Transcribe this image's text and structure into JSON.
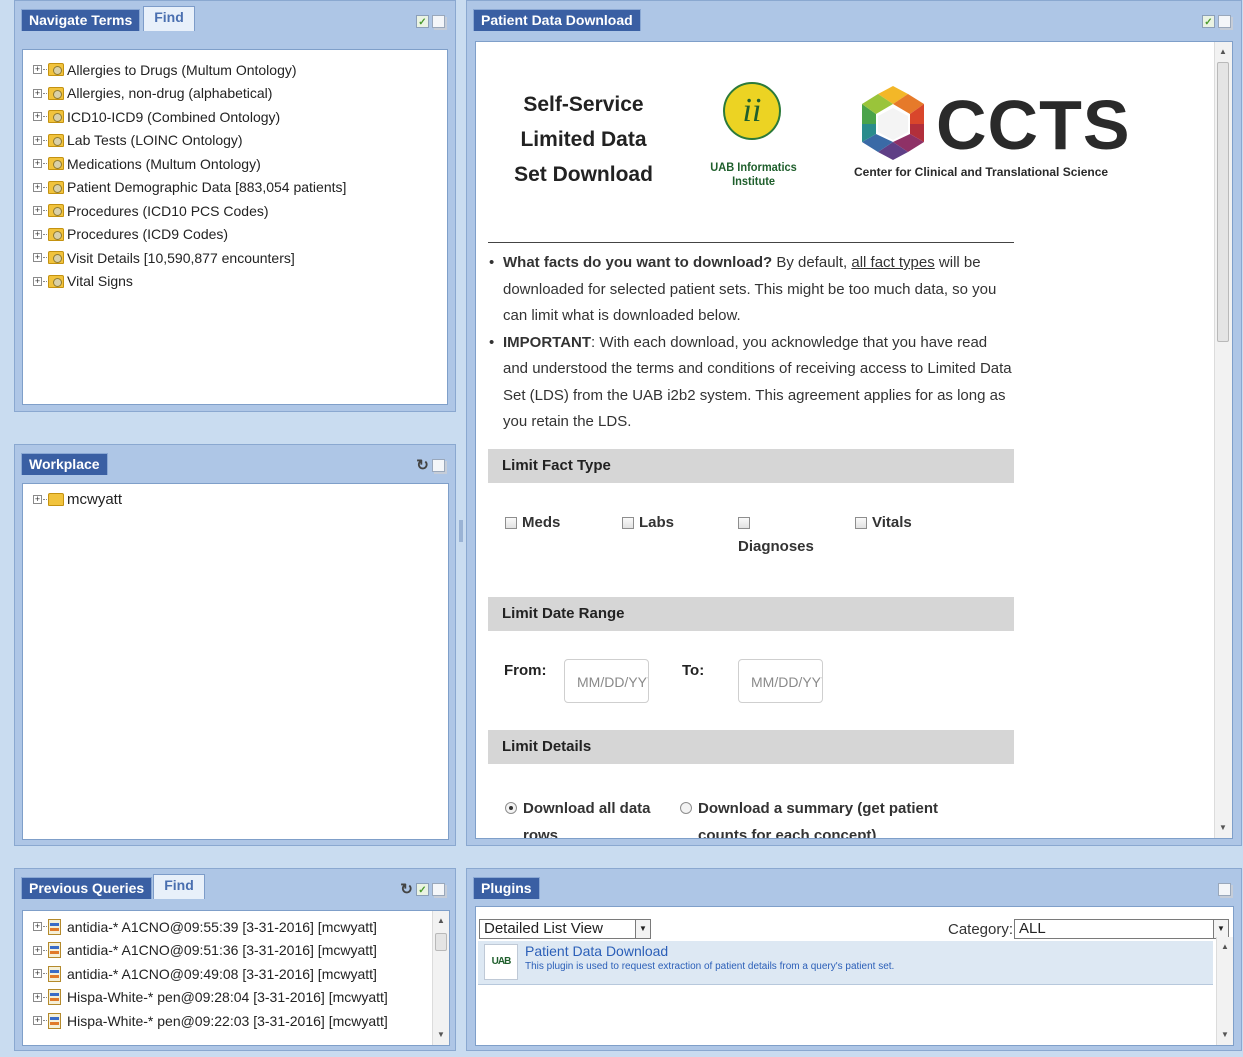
{
  "navigate": {
    "tab_active": "Navigate Terms",
    "tab_inactive": "Find",
    "items": [
      "Allergies to Drugs (Multum Ontology)",
      "Allergies, non-drug (alphabetical)",
      "ICD10-ICD9 (Combined Ontology)",
      "Lab Tests (LOINC Ontology)",
      "Medications (Multum Ontology)",
      "Patient Demographic Data [883,054 patients]",
      "Procedures (ICD10 PCS Codes)",
      "Procedures (ICD9 Codes)",
      "Visit Details [10,590,877 encounters]",
      "Vital Signs"
    ]
  },
  "workplace": {
    "tab": "Workplace",
    "items": [
      "mcwyatt"
    ]
  },
  "queries": {
    "tab_active": "Previous Queries",
    "tab_inactive": "Find",
    "items": [
      "antidia-* A1CNO@09:55:39 [3-31-2016] [mcwyatt]",
      "antidia-* A1CNO@09:51:36 [3-31-2016] [mcwyatt]",
      "antidia-* A1CNO@09:49:08 [3-31-2016] [mcwyatt]",
      "Hispa-White-* pen@09:28:04 [3-31-2016] [mcwyatt]",
      "Hispa-White-* pen@09:22:03 [3-31-2016] [mcwyatt]"
    ]
  },
  "download": {
    "tab": "Patient Data Download",
    "title_line1": "Self-Service",
    "title_line2": "Limited Data",
    "title_line3": "Set Download",
    "uab_logo_glyph": "ii",
    "uab_logo_text": "UAB Informatics Institute",
    "ccts_text": "CCTS",
    "ccts_subtitle": "Center for Clinical and Translational Science",
    "bullet1_bold": "What facts do you want to download?",
    "bullet1_a": " By default, ",
    "bullet1_link": "all fact types",
    "bullet1_b": " will be downloaded for selected patient sets. This might be too much data, so you can limit what is downloaded below.",
    "bullet2_bold": "IMPORTANT",
    "bullet2_text": ": With each download, you acknowledge that you have read and understood the terms and conditions of receiving access to Limited Data Set (LDS) from the UAB i2b2 system. This agreement applies for as long as you retain the LDS.",
    "section_fact": "Limit Fact Type",
    "cb_meds": "Meds",
    "cb_labs": "Labs",
    "cb_diagnoses": "Diagnoses",
    "cb_vitals": "Vitals",
    "section_date": "Limit Date Range",
    "from_label": "From:",
    "to_label": "To:",
    "date_placeholder": "MM/DD/YYYY",
    "section_details": "Limit Details",
    "radio_all": "Download all data rows",
    "radio_summary": "Download a summary (get patient counts for each concept)"
  },
  "plugins": {
    "tab": "Plugins",
    "view_select": "Detailed List View",
    "category_label": "Category:",
    "category_value": "ALL",
    "item_logo": "UAB",
    "item_title": "Patient Data Download",
    "item_desc": "This plugin is used to request extraction of patient details from a query's patient set."
  }
}
